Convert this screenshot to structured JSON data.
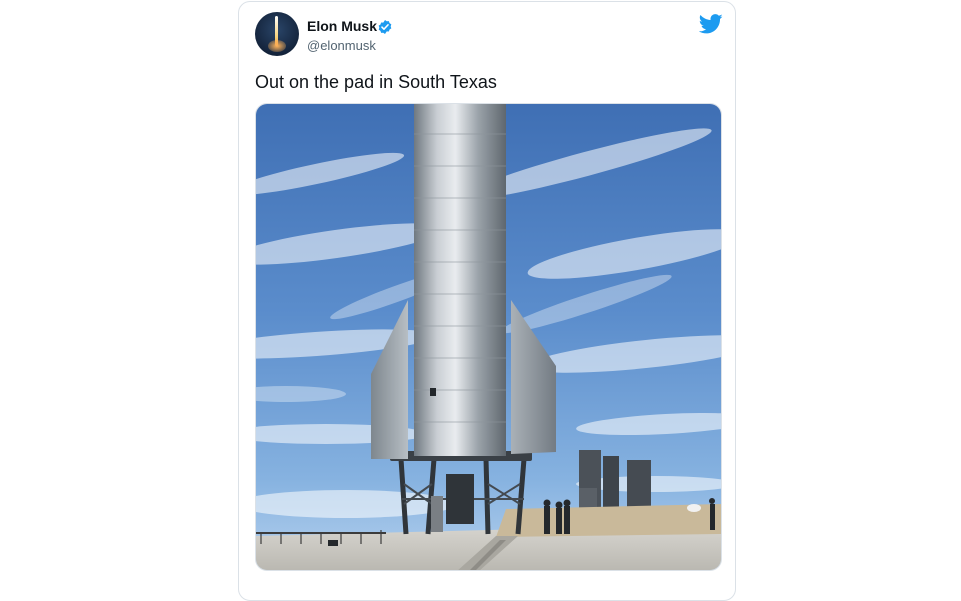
{
  "tweet": {
    "author_name": "Elon Musk",
    "author_handle": "@elonmusk",
    "verified": true,
    "text": "Out on the pad in South Texas"
  },
  "media": {
    "type": "photo",
    "alt": ""
  },
  "icons": {
    "avatar": "avatar-image",
    "verified": "verified-badge-icon",
    "brand": "twitter-bird-icon"
  },
  "colors": {
    "brand": "#1d9bf0",
    "text_primary": "#0f1419",
    "text_secondary": "#536471"
  }
}
